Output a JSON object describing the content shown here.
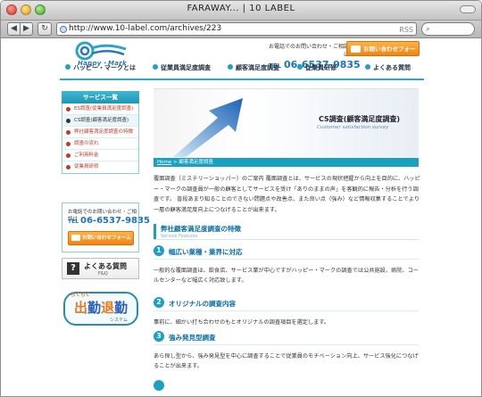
{
  "browser": {
    "title": "FARAWAY... | 10 LABEL",
    "back_glyph": "◀",
    "forward_glyph": "▶",
    "reload_glyph": "↻",
    "url": "http://www.10-label.com/archives/223",
    "rss_label": "RSS"
  },
  "header": {
    "logo_text": "Happy・Mark",
    "contact_label": "お電話でのお問い合わせ・ご相談は",
    "tel_prefix": "TEL",
    "tel_number": "06-6537-9835",
    "inquiry_button": "お問い合わせフォーム"
  },
  "nav": {
    "items": [
      {
        "label": "ハッピー・マークとは"
      },
      {
        "label": "従業員満足度調査"
      },
      {
        "label": "顧客満足度調査"
      },
      {
        "label": "従業員研修"
      },
      {
        "label": "よくある質問"
      }
    ]
  },
  "sidebar": {
    "heading": "サービス一覧",
    "items": [
      {
        "label": "ES調査(従業員満足度調査)"
      },
      {
        "label": "CS調査(顧客満足度調査)"
      },
      {
        "label": "弊社顧客満足度調査の特徴"
      },
      {
        "label": "調査の流れ"
      },
      {
        "label": "ご利用料金"
      },
      {
        "label": "従業員研修"
      }
    ],
    "contact_label": "お電話でのお問い合わせ・ご相談は",
    "tel_prefix": "TEL",
    "tel_number": "06-6537-9835",
    "inquiry_button": "お問い合わせフォーム",
    "faq_title": "よくある質問",
    "faq_sub": "F&Q",
    "shukkin_top": "らくらく",
    "shukkin_big_1": "出",
    "shukkin_big_2": "勤",
    "shukkin_big_3": "退",
    "shukkin_big_4": "勤",
    "shukkin_sub": "システム"
  },
  "banner": {
    "title": "CS調査(顧客満足度調査)",
    "subtitle": "Customer satisfaction survey"
  },
  "breadcrumb": {
    "home": "Home",
    "sep": " > ",
    "current": "顧客満足度調査"
  },
  "main": {
    "intro": "覆面調査（ミステリーショッパー）のご案内 覆面調査とは、サービスの現状把握から向上を目的に、ハッピー・マークの調査員が一般の顧客としてサービスを受け「ありのままの声」を客観的に報告・分析を行う調査です。 普段あまり知ることのできない問題点や改善点、また良い点（強み）など情報収集することでより一層の顧客満足度向上につなげることが出来ます。",
    "section_title": "弊社顧客満足度調査の特徴",
    "section_subtitle": "Service Features",
    "features": [
      {
        "num": "1",
        "title": "幅広い業種・業界に対応",
        "body": "一般的な覆面調査は、飲食店、サービス業が中心ですがハッピー・マークの調査では公共施設、病院、コールセンターなど幅広く対応致します。"
      },
      {
        "num": "2",
        "title": "オリジナルの調査内容",
        "body": "事前に、細かい打ち合わせのもとオリジナルの調査項目を選定します。"
      },
      {
        "num": "3",
        "title": "強み発見型調査",
        "body": "あら探し型から、強み発見型を中心に調査することで従業員のモチベーション向上、サービス強化につなげることが出来ます。"
      }
    ]
  }
}
